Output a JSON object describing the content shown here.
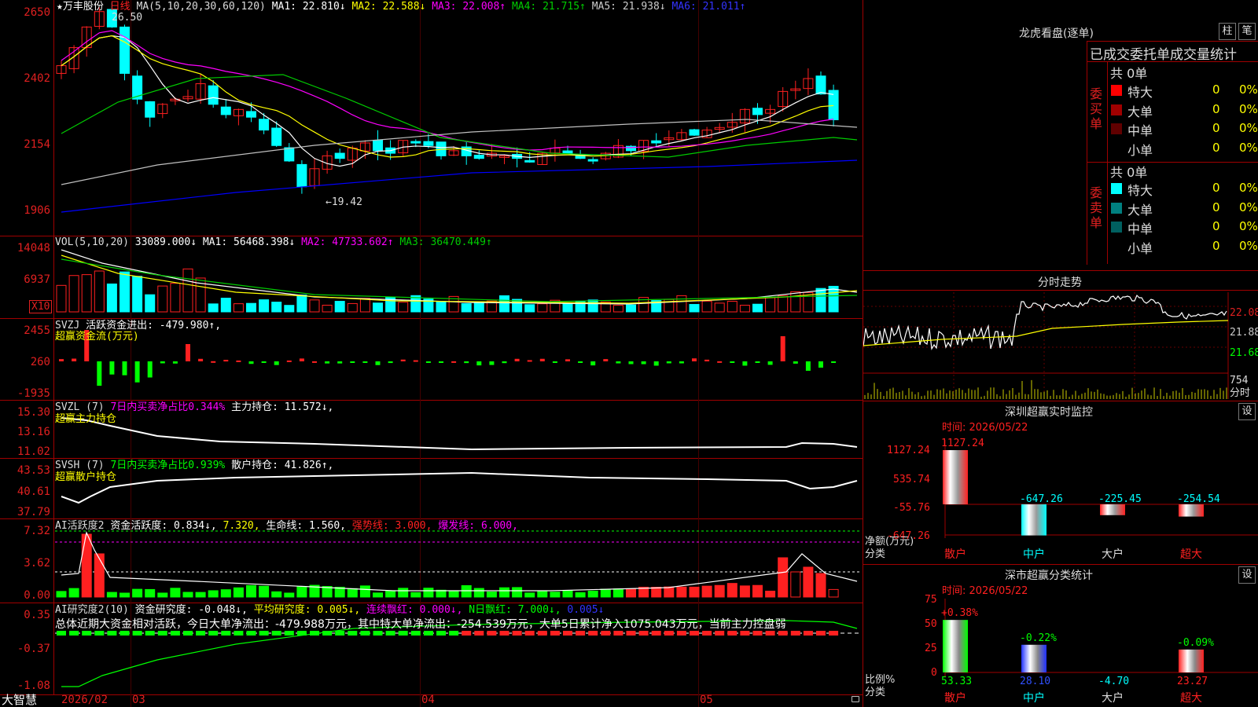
{
  "colors": {
    "up": "#ff2020",
    "down": "#00ffff",
    "ma1": "#ffffff",
    "ma2": "#ffff00",
    "ma3": "#ff00ff",
    "ma4": "#00cc00",
    "ma5": "#c0c0c0",
    "ma6": "#0000ff",
    "green": "#00ff00"
  },
  "brand": "大智慧",
  "kline": {
    "stock_name": "★万丰股份",
    "period": "日线",
    "ma_label": "MA(5,10,20,30,60,120)",
    "ma1": "MA1: 22.810↓",
    "ma2": "MA2: 22.588↓",
    "ma3": "MA3: 22.008↑",
    "ma4": "MA4: 21.715↑",
    "ma5": "MA5: 21.938↓",
    "ma6": "MA6: 21.011↑",
    "high_label": "26.50",
    "low_label": "←19.42",
    "y_ticks": [
      "2650",
      "2402",
      "2154",
      "1906"
    ]
  },
  "vol": {
    "label": "VOL(5,10,20)",
    "value": "33089.000↓",
    "ma1": "MA1: 56468.398↓",
    "ma2": "MA2: 47733.602↑",
    "ma3": "MA3: 36470.449↑",
    "y_ticks": [
      "14048",
      "6937"
    ],
    "unit": "X10"
  },
  "svzj": {
    "label": "SVZJ",
    "title": "活跃资金进出: -479.980↑,",
    "subtitle": "超赢资金流(万元)",
    "y_ticks": [
      "2455",
      "260",
      "-1935"
    ]
  },
  "svzl": {
    "label": "SVZL (7)",
    "ratio": "7日内买卖净占比0.344%",
    "main": "主力持仓: 11.572↓,",
    "subtitle": "超赢主力持仓",
    "y_ticks": [
      "15.30",
      "13.16",
      "11.02"
    ]
  },
  "svsh": {
    "label": "SVSH (7)",
    "ratio": "7日内买卖净占比0.939%",
    "retail": "散户持仓: 41.826↑,",
    "subtitle": "超赢散户持仓",
    "y_ticks": [
      "43.53",
      "40.61",
      "37.79"
    ]
  },
  "ai_active": {
    "label": "AI活跃度2",
    "a": "资金活跃度: 0.834↓,",
    "b": "7.320,",
    "c": "生命线: 1.560,",
    "d": "强势线: 3.000,",
    "e": "爆发线: 6.000,",
    "y_ticks": [
      "7.32",
      "3.62",
      "0.00"
    ]
  },
  "ai_research": {
    "label": "AI研究度2(10)",
    "a": "资金研究度: -0.048↓,",
    "b": "平均研究度: 0.005↓,",
    "c": "连续飘红: 0.000↓,",
    "d": "N日飘红: 7.000↓,",
    "e": "0.005↓",
    "summary": "总体近期大资金相对活跃，今日大单净流出：-479.988万元，其中特大单净流出：-254.539万元，大单5日累计净入1075.043万元，当前主力控盘弱",
    "y_ticks": [
      "0.35",
      "-0.37",
      "-1.08"
    ]
  },
  "x_axis": [
    "2026/02",
    "03",
    "04",
    "05"
  ],
  "lhb": {
    "title": "龙虎看盘(逐单)",
    "btn_a": "柱",
    "btn_b": "笔",
    "header": "已成交委托单成交量统计",
    "buy": {
      "side": "委买单",
      "total": "共 0单",
      "rows": [
        {
          "name": "特大",
          "v": "0",
          "p": "0%"
        },
        {
          "name": "大单",
          "v": "0",
          "p": "0%"
        },
        {
          "name": "中单",
          "v": "0",
          "p": "0%"
        },
        {
          "name": "小单",
          "v": "0",
          "p": "0%"
        }
      ]
    },
    "sell": {
      "side": "委卖单",
      "total": "共 0单",
      "rows": [
        {
          "name": "特大",
          "v": "0",
          "p": "0%"
        },
        {
          "name": "大单",
          "v": "0",
          "p": "0%"
        },
        {
          "name": "中单",
          "v": "0",
          "p": "0%"
        },
        {
          "name": "小单",
          "v": "0",
          "p": "0%"
        }
      ]
    }
  },
  "intraday": {
    "title": "分时走势",
    "y": [
      "22.08",
      "21.88",
      "21.68"
    ],
    "vol_value": "754",
    "vol_unit": "分时"
  },
  "monitor": {
    "title": "深圳超赢实时监控",
    "btn": "设",
    "time": "时间: 2026/05/22",
    "y": [
      "1127.24",
      "535.74",
      "-55.76",
      "-647.26"
    ],
    "ylabel_a": "净额(万元)",
    "ylabel_b": "分类",
    "cats": [
      "散户",
      "中户",
      "大户",
      "超大"
    ],
    "values": [
      1127.24,
      -647.26,
      -225.45,
      -254.54
    ],
    "labels": [
      "1127.24",
      "-647.26",
      "-225.45",
      "-254.54"
    ]
  },
  "classify": {
    "title": "深市超赢分类统计",
    "btn": "设",
    "time": "时间: 2026/05/22",
    "y": [
      "75",
      "50",
      "25",
      "0"
    ],
    "ylabel_a": "比例%",
    "ylabel_b": "分类",
    "cats": [
      "散户",
      "中户",
      "大户",
      "超大"
    ],
    "values": [
      53.33,
      28.1,
      -4.7,
      23.27
    ],
    "bottom_labels": [
      "53.33",
      "28.10",
      "-4.70",
      "23.27"
    ],
    "top_labels": [
      "+0.38%",
      "-0.22%",
      "",
      "-0.09%"
    ]
  }
}
